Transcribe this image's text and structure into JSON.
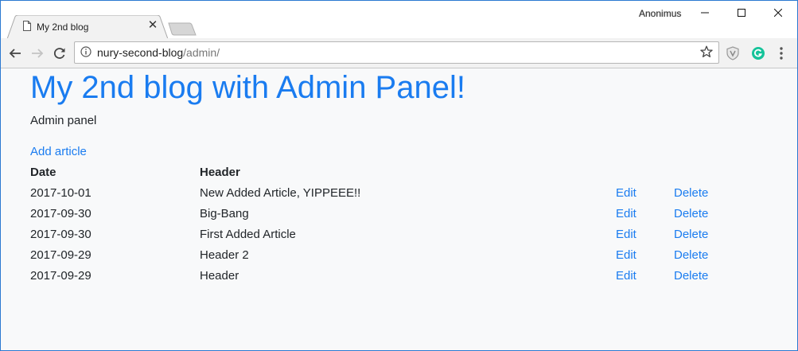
{
  "browser": {
    "tab_title": "My 2nd blog",
    "profile_name": "Anonimus",
    "url_host": "nury-second-blog",
    "url_path": "/admin/"
  },
  "page": {
    "title": "My 2nd blog with Admin Panel!",
    "subtitle": "Admin panel",
    "add_article_label": "Add article",
    "columns": {
      "date": "Date",
      "header": "Header"
    },
    "rows": [
      {
        "date": "2017-10-01",
        "header": "New Added Article, YIPPEEE!!",
        "edit": "Edit",
        "delete": "Delete"
      },
      {
        "date": "2017-09-30",
        "header": "Big-Bang",
        "edit": "Edit",
        "delete": "Delete"
      },
      {
        "date": "2017-09-30",
        "header": "First Added Article",
        "edit": "Edit",
        "delete": "Delete"
      },
      {
        "date": "2017-09-29",
        "header": "Header 2",
        "edit": "Edit",
        "delete": "Delete"
      },
      {
        "date": "2017-09-29",
        "header": "Header",
        "edit": "Edit",
        "delete": "Delete"
      }
    ]
  },
  "colors": {
    "accent": "#1a7cf0",
    "text": "#212529",
    "background": "#f8f9fa",
    "window_border": "#2b79d1"
  },
  "icons": [
    "page-icon",
    "close-icon",
    "minimize-icon",
    "maximize-icon",
    "window-close-icon",
    "back-icon",
    "forward-icon",
    "reload-icon",
    "info-icon",
    "star-icon",
    "shield-extension-icon",
    "grammarly-icon",
    "kebab-menu-icon"
  ]
}
